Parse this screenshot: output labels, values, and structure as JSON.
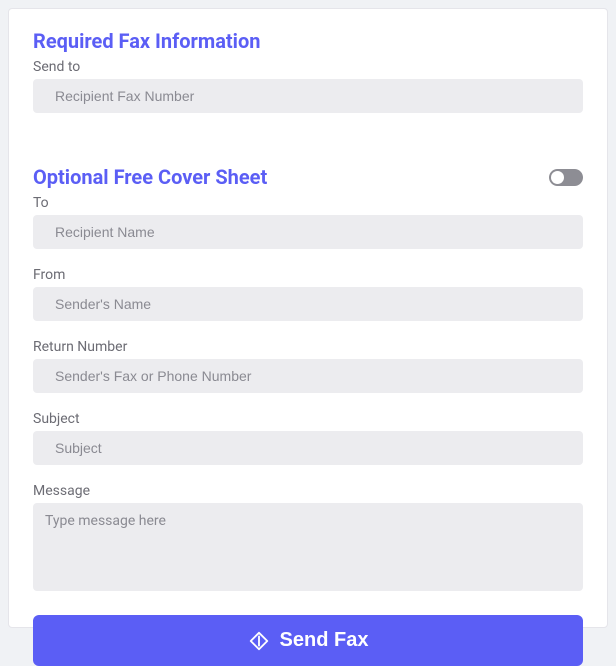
{
  "required": {
    "title": "Required Fax Information",
    "sendto_label": "Send to",
    "sendto_placeholder": "Recipient Fax Number",
    "sendto_value": ""
  },
  "optional": {
    "title": "Optional Free Cover Sheet",
    "toggle_on": false,
    "to_label": "To",
    "to_placeholder": "Recipient Name",
    "to_value": "",
    "from_label": "From",
    "from_placeholder": "Sender's Name",
    "from_value": "",
    "return_label": "Return Number",
    "return_placeholder": "Sender's Fax or Phone Number",
    "return_value": "",
    "subject_label": "Subject",
    "subject_placeholder": "Subject",
    "subject_value": "",
    "message_label": "Message",
    "message_placeholder": "Type message here",
    "message_value": ""
  },
  "button": {
    "label": "Send Fax"
  },
  "colors": {
    "accent": "#5b5ef5",
    "input_bg": "#ececef"
  }
}
